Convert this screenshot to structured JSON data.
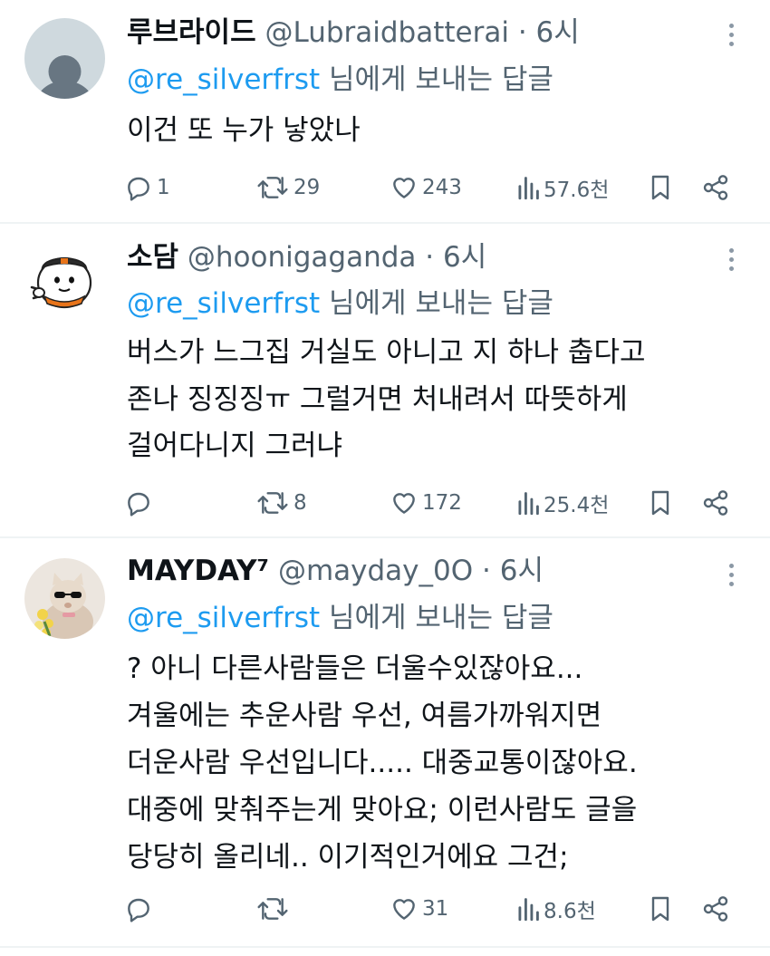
{
  "tweets": [
    {
      "display_name": "루브라이드",
      "handle": "@Lubraidbatterai",
      "time": "6시",
      "reply_handle": "@re_silverfrst",
      "reply_suffix": "님에게 보내는 답글",
      "body": [
        "이건 또 누가 낳았나"
      ],
      "replies": "1",
      "retweets": "29",
      "likes": "243",
      "views": "57.6천",
      "avatar": "default-avatar"
    },
    {
      "display_name": "소담",
      "handle": "@hoonigaganda",
      "time": "6시",
      "reply_handle": "@re_silverfrst",
      "reply_suffix": "님에게 보내는 답글",
      "body": [
        "버스가 느그집 거실도 아니고 지 하나 춥다고",
        "존나 징징징ㅠ 그럴거면 처내려서 따뜻하게",
        "걸어다니지 그러냐"
      ],
      "replies": "",
      "retweets": "8",
      "likes": "172",
      "views": "25.4천",
      "avatar": "cartoon-character-avatar"
    },
    {
      "display_name": "MAYDAY⁷",
      "handle": "@mayday_0O",
      "time": "6시",
      "reply_handle": "@re_silverfrst",
      "reply_suffix": "님에게 보내는 답글",
      "body": [
        "?  아니 다른사람들은 더울수있잖아요...",
        "겨울에는 추운사람 우선, 여름가까워지면",
        "더운사람 우선입니다.....  대중교통이잖아요.",
        "대중에 맞춰주는게 맞아요;  이런사람도 글을",
        "당당히 올리네.. 이기적인거에요 그건;"
      ],
      "replies": "",
      "retweets": "",
      "likes": "31",
      "views": "8.6천",
      "avatar": "cat-with-sunglasses-avatar"
    }
  ],
  "colors": {
    "accent": "#1d9bf0",
    "muted": "#536471",
    "text": "#0f1419",
    "divider": "#eff3f4"
  },
  "icons": {
    "reply": "speech-bubble-icon",
    "retweet": "retweet-icon",
    "like": "heart-icon",
    "views": "bar-chart-icon",
    "bookmark": "bookmark-icon",
    "share": "share-icon",
    "more": "more-dots-icon"
  }
}
